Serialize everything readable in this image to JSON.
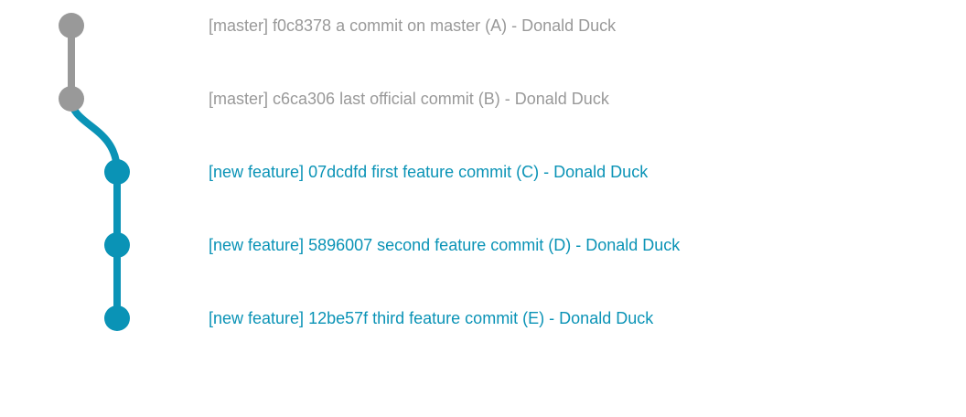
{
  "colors": {
    "master": "#999999",
    "feature": "#0a93b6",
    "background": "#ffffff"
  },
  "branches": [
    {
      "name": "master",
      "color_key": "master"
    },
    {
      "name": "new feature",
      "color_key": "feature"
    }
  ],
  "commits": [
    {
      "branch": "master",
      "label": "[master] f0c8378 a commit on master (A) - Donald Duck"
    },
    {
      "branch": "master",
      "label": "[master] c6ca306 last official commit (B) - Donald Duck"
    },
    {
      "branch": "new feature",
      "label": "[new feature] 07dcdfd first feature commit (C) - Donald Duck"
    },
    {
      "branch": "new feature",
      "label": "[new feature] 5896007 second feature commit (D) - Donald Duck"
    },
    {
      "branch": "new feature",
      "label": "[new feature] 12be57f third feature commit (E) - Donald Duck"
    }
  ]
}
